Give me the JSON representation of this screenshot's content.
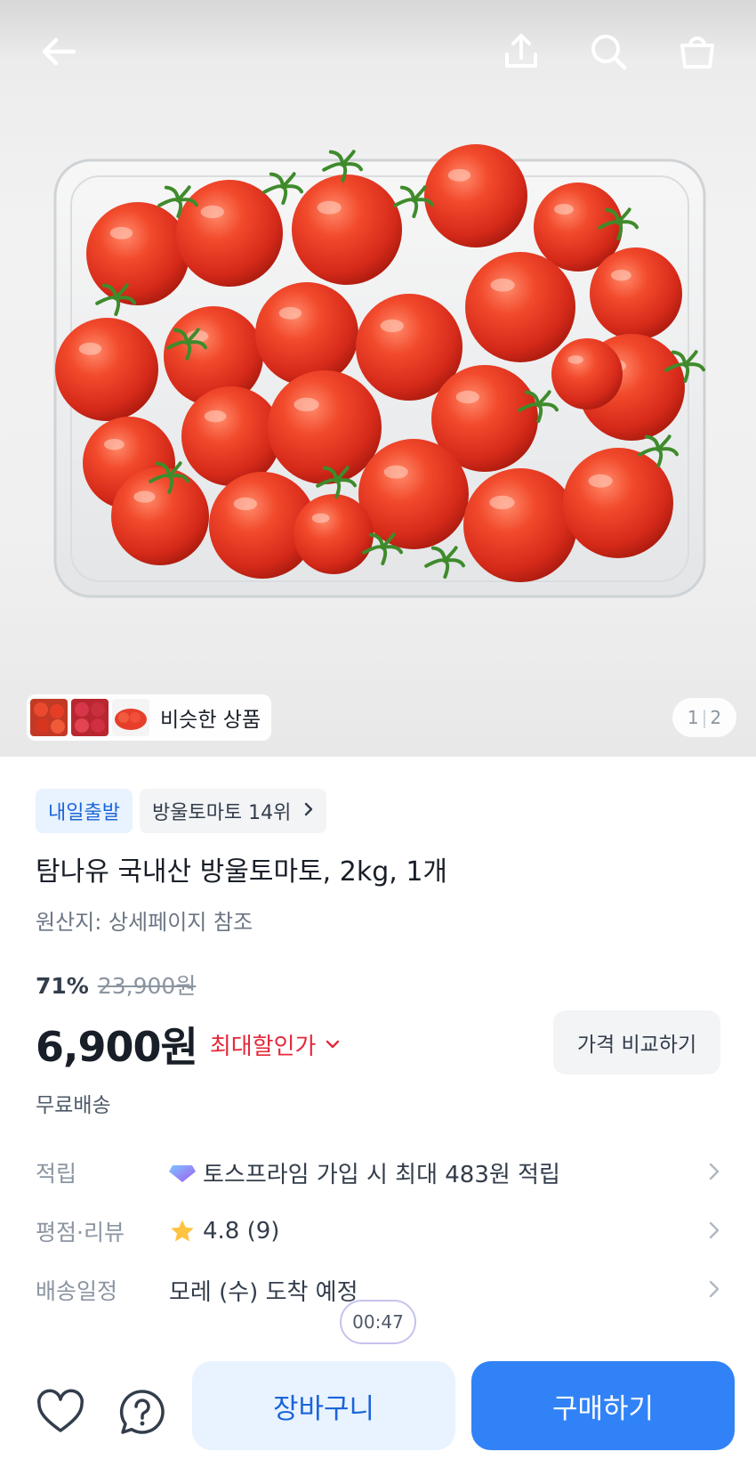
{
  "hero": {
    "similar_label": "비슷한 상품",
    "pager": {
      "current": "1",
      "total": "2"
    }
  },
  "product": {
    "badges": [
      {
        "text": "내일출발"
      },
      {
        "text": "방울토마토 14위"
      }
    ],
    "title": "탐나유 국내산 방울토마토, 2kg, 1개",
    "origin": "원산지: 상세페이지 참조",
    "discount_pct": "71%",
    "original_price": "23,900원",
    "price": "6,900원",
    "max_discount_label": "최대할인가",
    "compare_label": "가격 비교하기",
    "shipping": "무료배송"
  },
  "info": [
    {
      "key": "적립",
      "value": "토스프라임 가입 시 최대 483원 적립"
    },
    {
      "key": "평점·리뷰",
      "value": "4.8 (9)"
    },
    {
      "key": "배송일정",
      "value": "모레 (수) 도착 예정"
    }
  ],
  "timer": "00:47",
  "bottom": {
    "cart_label": "장바구니",
    "buy_label": "구매하기"
  },
  "colors": {
    "accent": "#3182f6",
    "accent_light": "#e8f3ff",
    "discount_red": "#e42939",
    "star": "#ffc342"
  },
  "icons": [
    "back-arrow-icon",
    "share-icon",
    "search-icon",
    "shopping-bag-icon",
    "chevron-right-icon",
    "chevron-down-icon",
    "prime-gem-icon",
    "star-icon",
    "heart-icon",
    "help-icon"
  ]
}
